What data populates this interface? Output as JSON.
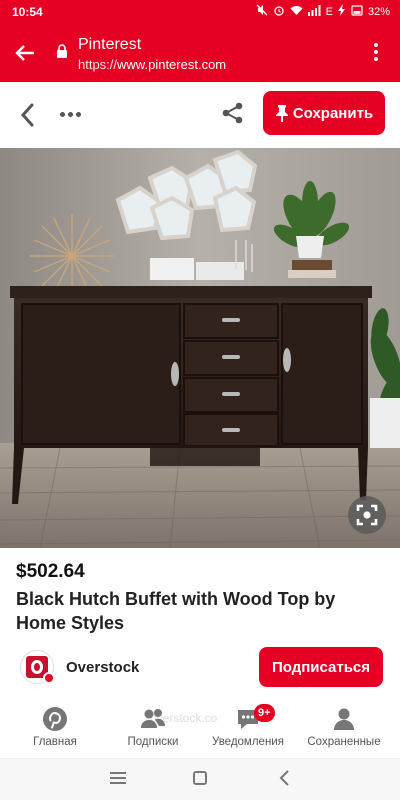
{
  "status_bar": {
    "time": "10:54",
    "network": "E",
    "battery": "32%"
  },
  "browser": {
    "title": "Pinterest",
    "url_prefix": "https://",
    "url_host": "www.pinterest.com"
  },
  "toolbar": {
    "save_label": "Сохранить"
  },
  "pin": {
    "price": "$502.64",
    "title": "Black Hutch Buffet with Wood Top by Home Styles",
    "source_name": "Overstock",
    "follow_label": "Подписаться",
    "ghost_text": "overstock.co"
  },
  "tabs": [
    {
      "label": "Главная",
      "icon": "pinterest-logo-icon"
    },
    {
      "label": "Подписки",
      "icon": "people-icon"
    },
    {
      "label": "Уведомления",
      "icon": "chat-bubble-icon",
      "badge": "9+"
    },
    {
      "label": "Сохраненные",
      "icon": "person-icon"
    }
  ],
  "colors": {
    "brand": "#e60023"
  }
}
